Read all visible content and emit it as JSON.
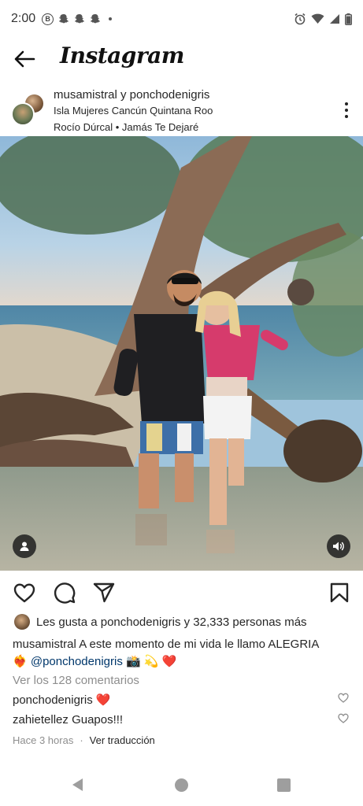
{
  "status_bar": {
    "time": "2:00",
    "left_icons": [
      "b-badge-icon",
      "snapchat-icon",
      "snapchat-icon",
      "snapchat-icon",
      "dot-icon"
    ],
    "right_icons": [
      "alarm-icon",
      "wifi-icon",
      "signal-icon",
      "battery-icon"
    ]
  },
  "app_bar": {
    "brand": "Instagram"
  },
  "post": {
    "users": "musamistral y ponchodenigris",
    "location": "Isla Mujeres Cancún Quintana Roo",
    "music": "Rocío Dúrcal • Jamás Te Dejaré",
    "likes_text": "Les gusta a ponchodenigris y 32,333 personas más",
    "caption_user": "musamistral",
    "caption_text": "A este momento de mi vida le llamo ALEGRIA",
    "caption_mention": "@ponchodenigris",
    "caption_emojis_left": "❤️‍🔥",
    "caption_emojis_right": "📸 💫 ❤️",
    "view_comments": "Ver los 128 comentarios",
    "comments": [
      {
        "user": "ponchodenigris",
        "text": "❤️"
      },
      {
        "user": "zahietellez",
        "text": "Guapos!!!"
      }
    ],
    "time_ago": "Hace 3 horas",
    "separator": "·",
    "translate": "Ver traducción"
  },
  "colors": {
    "text": "#262626",
    "muted": "#8e8e8e",
    "mention": "#00376b",
    "heart_red": "#ed4956"
  }
}
